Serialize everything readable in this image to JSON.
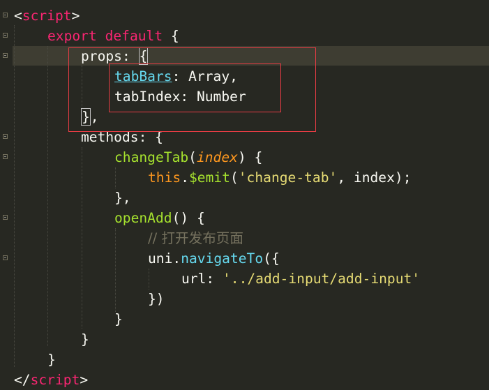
{
  "colors": {
    "background": "#272822",
    "annotation_box": "#e63c44"
  },
  "lines": {
    "l1": {
      "open": "<",
      "name": "script",
      "close": ">"
    },
    "l2": {
      "kw1": "export",
      "kw2": "default",
      "brace": "{"
    },
    "l3": {
      "key": "props",
      "colon": ": ",
      "brace": "{"
    },
    "l4": {
      "key": "tabBars",
      "rest": ": Array,"
    },
    "l5": {
      "text": "tabIndex: Number"
    },
    "l6": {
      "brace": "}",
      "rest": ","
    },
    "l7": {
      "text": "methods: {"
    },
    "l8": {
      "fn": "changeTab",
      "open": "(",
      "param": "index",
      "close": ") {"
    },
    "l9": {
      "this": "this",
      "dot": ".",
      "emit": "$emit",
      "open": "(",
      "str": "'change-tab'",
      "rest": ", index);"
    },
    "l10": {
      "text": "},"
    },
    "l11": {
      "fn": "openAdd",
      "rest": "() {"
    },
    "l12": {
      "comment": "// 打开发布页面"
    },
    "l13": {
      "obj": "uni",
      "dot": ".",
      "method": "navigateTo",
      "rest": "({"
    },
    "l14": {
      "key": "url",
      "colon": ": ",
      "str": "'../add-input/add-input'"
    },
    "l15": {
      "text": "})"
    },
    "l16": {
      "text": "}"
    },
    "l17": {
      "text": "}"
    },
    "l18": {
      "text": "}"
    },
    "l19": {
      "open": "</",
      "name": "script",
      "close": ">"
    }
  }
}
